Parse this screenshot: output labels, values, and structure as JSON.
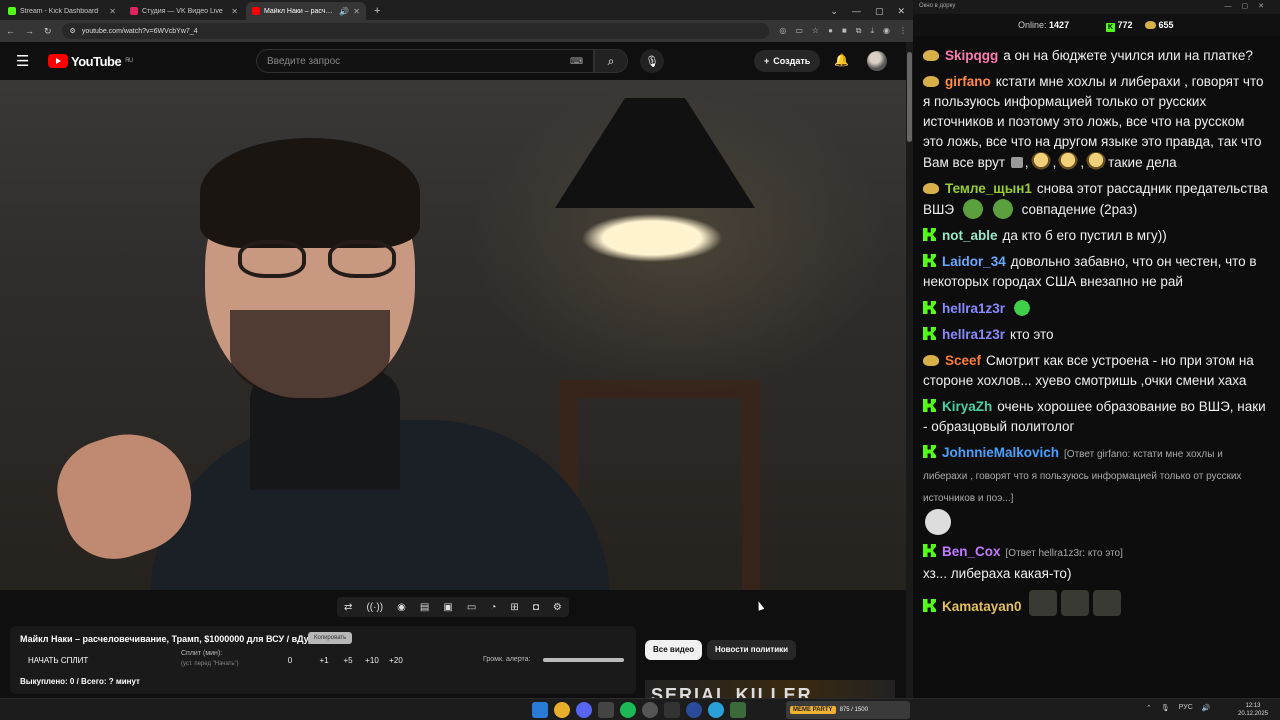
{
  "browser": {
    "tabs": [
      {
        "label": "Stream - Kick Dashboard",
        "color": "#53fc18"
      },
      {
        "label": "Студия — VK Видео Live",
        "color": "#e0245e"
      },
      {
        "label": "Майкл Наки – расчеловечи…",
        "color": "#ff0000"
      }
    ],
    "url": "youtube.com/watch?v=6WVcbYw7_4"
  },
  "youtube": {
    "logo_text": "YouTube",
    "region": "RU",
    "search_placeholder": "Введите запрос",
    "create_label": "Создать",
    "chips": [
      "Все видео",
      "Новости политики"
    ],
    "thumbnail_text": "SERIAL KILLER"
  },
  "vk_panel": {
    "title": "Майкл Наки – расчеловечивание, Трамп, $1000000 для ВСУ / вДудь",
    "copy_label": "Копировать",
    "start_split": "НАЧАТЬ СПЛИТ",
    "split_label": "Сплит (мин):",
    "split_hint": "(уст. перед \"Начать\")",
    "split_values": [
      "0",
      "+1",
      "+5",
      "+10",
      "+20"
    ],
    "volume_label": "Громк. алерта:",
    "volume_level": 1.0,
    "bought": "Выкуплено: 0 / Всего: ? минут"
  },
  "chat": {
    "window_title": "Окно в дорку",
    "online_label": "Online:",
    "online_count": "1427",
    "kick_count": "772",
    "gold_count": "655",
    "messages": [
      {
        "badge": "gold",
        "user": "Skipqgg",
        "color": "#ff7bb0",
        "text": "а он на бюджете учился или на платке?"
      },
      {
        "badge": "gold",
        "user": "girfano",
        "color": "#ff8a4a",
        "text": "кстати мне хохлы и либерахи , говорят что я пользуюсь информацией только от русских источников и поэтому это ложь, все что на русском это ложь, все что на другом языке это правда, так что Вам все врут",
        "tail": "такие дела"
      },
      {
        "badge": "gold",
        "user": "Темле_щын1",
        "color": "#9acd32",
        "text": "снова этот рассадник предательства ВШЭ",
        "tail": "совпадение (2раз)"
      },
      {
        "badge": "kick",
        "user": "not_able",
        "color": "#9ae6c8",
        "text": "да кто б его пустил в мгу))"
      },
      {
        "badge": "kick",
        "user": "Laidor_34",
        "color": "#6aa8ff",
        "text": "довольно забавно, что он честен, что в некоторых городах США внезапно не рай"
      },
      {
        "badge": "kick",
        "user": "hellra1z3r",
        "color": "#8a8aff",
        "text": ""
      },
      {
        "badge": "kick",
        "user": "hellra1z3r",
        "color": "#8a8aff",
        "text": "кто это"
      },
      {
        "badge": "gold",
        "user": "Sceef",
        "color": "#ff7b3a",
        "text": "Смотрит как все устроена - но при этом на стороне хохлов... хуево смотришь ,очки смени хаха"
      },
      {
        "badge": "kick",
        "user": "KiryaZh",
        "color": "#4ad0a0",
        "text": "очень хорошее образование во ВШЭ, наки - образцовый политолог"
      },
      {
        "badge": "kick",
        "user": "JohnnieMalkovich",
        "color": "#4aa0ff",
        "reply": "[Ответ girfano: кстати мне хохлы и либерахи , говорят что я пользуюсь информацией только от русских источников и поэ...]",
        "text": ""
      },
      {
        "badge": "kick",
        "user": "Ben_Cox",
        "color": "#c07aff",
        "reply": "[Ответ hellra1z3r: кто это]",
        "text": "хз... либераха какая-то)"
      },
      {
        "badge": "kick",
        "user": "Kamatayan0",
        "color": "#e0c060",
        "text": ""
      }
    ]
  },
  "taskbar": {
    "promo_label": "MEME PARTY",
    "promo_count": "875 / 1500",
    "lang": "РУС",
    "time": "12:13",
    "date": "20.12.2025"
  }
}
